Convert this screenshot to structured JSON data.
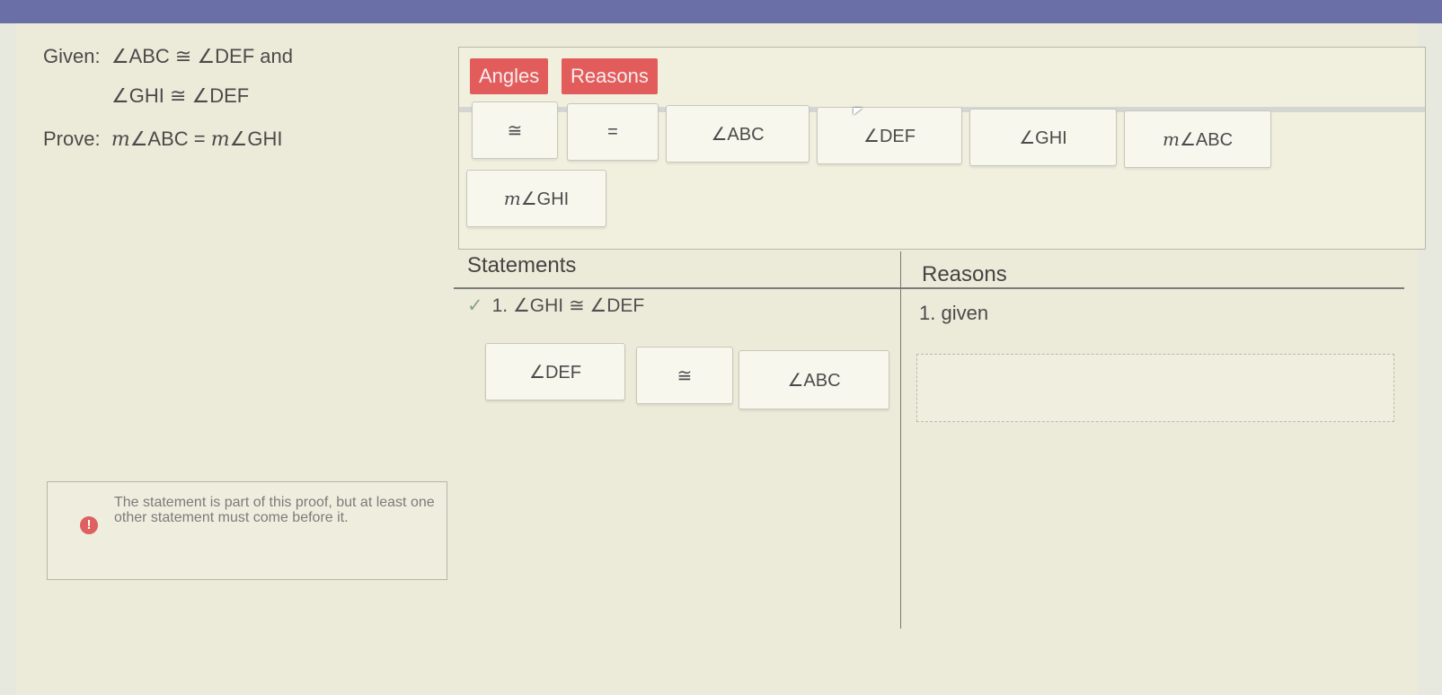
{
  "given": {
    "line1_prefix": "Given:",
    "line1_expr": "∠ABC ≅ ∠DEF",
    "line1_suffix": "and",
    "line2_expr": "∠GHI ≅ ∠DEF",
    "prove_label": "Prove:",
    "prove_m1": "m",
    "prove_expr1": "∠ABC =",
    "prove_m2": "m",
    "prove_expr2": "∠GHI"
  },
  "tabs": {
    "angles": "Angles",
    "reasons": "Reasons"
  },
  "palette": {
    "congruent": "≅",
    "equals": "=",
    "angle_abc": "∠ABC",
    "angle_def": "∠DEF",
    "angle_ghi": "∠GHI",
    "m_angle_abc_m": "m",
    "m_angle_abc": "∠ABC",
    "m_angle_ghi_m": "m",
    "m_angle_ghi": "∠GHI"
  },
  "proof": {
    "statements_header": "Statements",
    "reasons_header": "Reasons",
    "row1": {
      "check": "✓",
      "statement": "1. ∠GHI ≅ ∠DEF",
      "reason": "1. given"
    },
    "row2_tokens": [
      "∠DEF",
      "≅",
      "∠ABC"
    ]
  },
  "alert": {
    "icon": "!",
    "message": "The statement is part of this proof, but at least one other statement must come before it."
  },
  "colors": {
    "tab_bg": "#e25c5c",
    "alert_icon": "#de6060"
  }
}
